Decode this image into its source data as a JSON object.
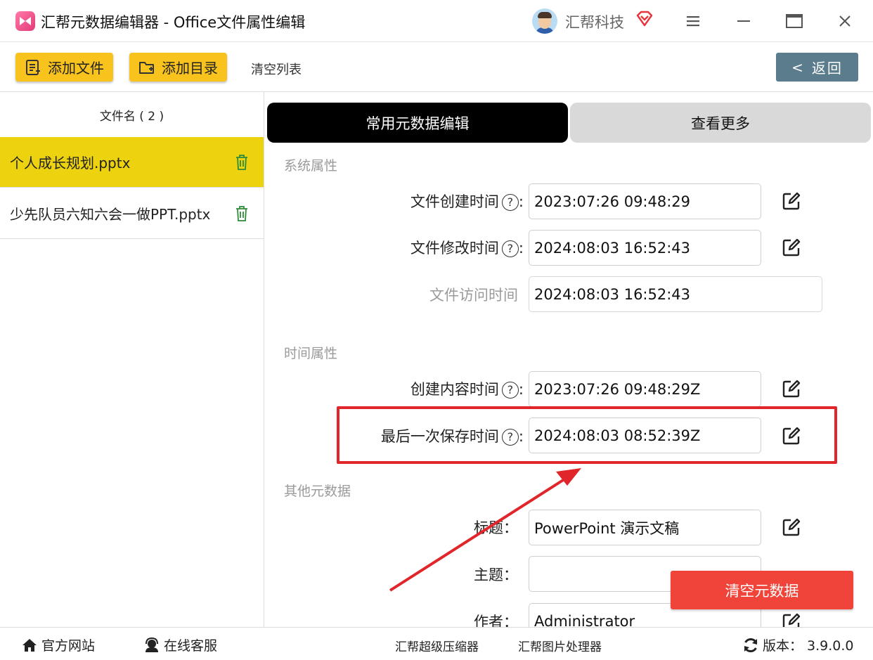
{
  "app": {
    "title": "汇帮元数据编辑器 - Office文件属性编辑",
    "brand": "汇帮科技"
  },
  "toolbar": {
    "add_file": "添加文件",
    "add_dir": "添加目录",
    "clear_list": "清空列表",
    "back": "返回"
  },
  "file_list": {
    "header": "文件名 ( 2 )",
    "items": [
      {
        "name": "个人成长规划.pptx",
        "selected": true
      },
      {
        "name": "少先队员六知六会一做PPT.pptx",
        "selected": false
      }
    ]
  },
  "tabs": {
    "common": "常用元数据编辑",
    "more": "查看更多"
  },
  "sections": {
    "system": "系统属性",
    "time": "时间属性",
    "other": "其他元数据"
  },
  "fields": {
    "file_created": {
      "label": "文件创建时间",
      "value": "2023:07:26 09:48:29"
    },
    "file_modified": {
      "label": "文件修改时间",
      "value": "2024:08:03 16:52:43"
    },
    "file_accessed": {
      "label": "文件访问时间",
      "value": "2024:08:03 16:52:43"
    },
    "content_created": {
      "label": "创建内容时间",
      "value": "2023:07:26 09:48:29Z"
    },
    "last_saved": {
      "label": "最后一次保存时间",
      "value": "2024:08:03 08:52:39Z"
    },
    "title": {
      "label": "标题：",
      "value": "PowerPoint 演示文稿"
    },
    "subject": {
      "label": "主题：",
      "value": ""
    },
    "author": {
      "label": "作者：",
      "value": "Administrator"
    }
  },
  "help_glyph": "?",
  "colon": ":",
  "clear_metadata": "清空元数据",
  "bottom": {
    "website": "官方网站",
    "support": "在线客服",
    "compressor": "汇帮超级压缩器",
    "image_tool": "汇帮图片处理器",
    "version": "版本：  3.9.0.0"
  },
  "colors": {
    "accent_yellow": "#f7c31c",
    "selected_row": "#ecd20f",
    "back_button": "#5b7c8c",
    "highlight_red": "#e0262b",
    "clear_button": "#f0443a"
  }
}
